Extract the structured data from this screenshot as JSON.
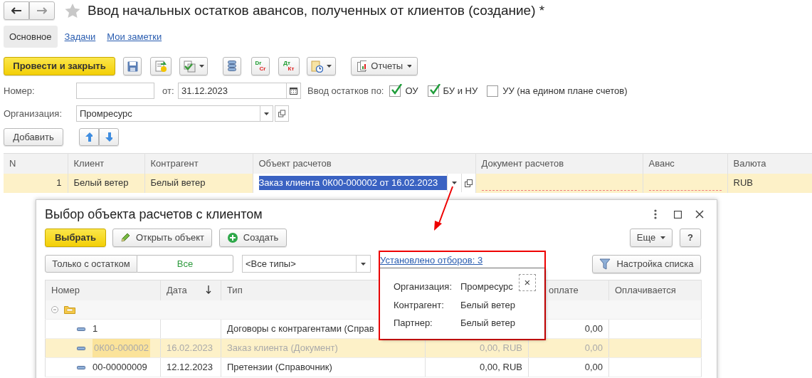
{
  "window": {
    "title": "Ввод начальных остатков авансов, полученных от клиентов (создание) *"
  },
  "tabs": [
    {
      "label": "Основное",
      "selected": true
    },
    {
      "label": "Задачи",
      "selected": false
    },
    {
      "label": "Мои заметки",
      "selected": false
    }
  ],
  "toolbar": {
    "primary": "Провести и закрыть",
    "dr_cr": [
      "Dr",
      "Cr"
    ],
    "dt_kt": [
      "Дт",
      "Кт"
    ],
    "reports": "Отчеты"
  },
  "form": {
    "number_label": "Номер:",
    "date_label": "от:",
    "date": "31.12.2023",
    "balances_label": "Ввод остатков по:",
    "options": [
      {
        "label": "ОУ",
        "checked": true
      },
      {
        "label": "БУ и НУ",
        "checked": true
      },
      {
        "label": "УУ (на едином плане счетов)",
        "checked": false
      }
    ],
    "organization_label": "Организация:",
    "organization": "Промресурс"
  },
  "table_toolbar": {
    "add": "Добавить"
  },
  "table": {
    "columns": [
      "N",
      "Клиент",
      "Контрагент",
      "Объект расчетов",
      "Документ расчетов",
      "Аванс",
      "Валюта"
    ],
    "rows": [
      {
        "n": "1",
        "client": "Белый ветер",
        "counterparty": "Белый ветер",
        "object": "Заказ клиента 0К00-000002 от 16.02.2023",
        "currency": "RUB",
        "selected": true
      }
    ]
  },
  "dialog": {
    "title": "Выбор объекта расчетов с клиентом",
    "select": "Выбрать",
    "open": "Открыть объект",
    "create": "Создать",
    "more": "Еще",
    "help": "?",
    "toggle": [
      {
        "label": "Только с остатком",
        "selected": false
      },
      {
        "label": "Все",
        "selected": true
      }
    ],
    "type_filter": "<Все типы>",
    "filters_link": "Установлено отборов: 3",
    "settings": "Настройка списка",
    "columns": [
      {
        "label": "Номер",
        "sorted": false
      },
      {
        "label": "Дата",
        "sorted": true
      },
      {
        "label": "Тип",
        "sorted": false
      },
      {
        "label": "оплате",
        "sorted": false
      },
      {
        "label": "Оплачивается",
        "sorted": false
      }
    ],
    "rows": [
      {
        "kind": "group",
        "expanded": true
      },
      {
        "kind": "item",
        "number": "1",
        "type": "Договоры с контрагентами (Справ",
        "column_5": "0,00",
        "selected": false
      },
      {
        "kind": "item",
        "number": "0К00-000002",
        "date": "16.02.2023",
        "type": "Заказ клиента (Документ)",
        "column_4": "0,00, RUB",
        "column_5": "0,00",
        "selected": true
      },
      {
        "kind": "item",
        "number": "00-00000009",
        "date": "12.12.2023",
        "type": "Претензии (Справочник)",
        "column_4": "0,00, RUB",
        "column_5": "0,00",
        "selected": false
      }
    ],
    "popup": {
      "close": "×",
      "rows": [
        {
          "label": "Организация:",
          "value": "Промресурс"
        },
        {
          "label": "Контрагент:",
          "value": "Белый ветер"
        },
        {
          "label": "Партнер:",
          "value": "Белый ветер"
        }
      ]
    }
  }
}
